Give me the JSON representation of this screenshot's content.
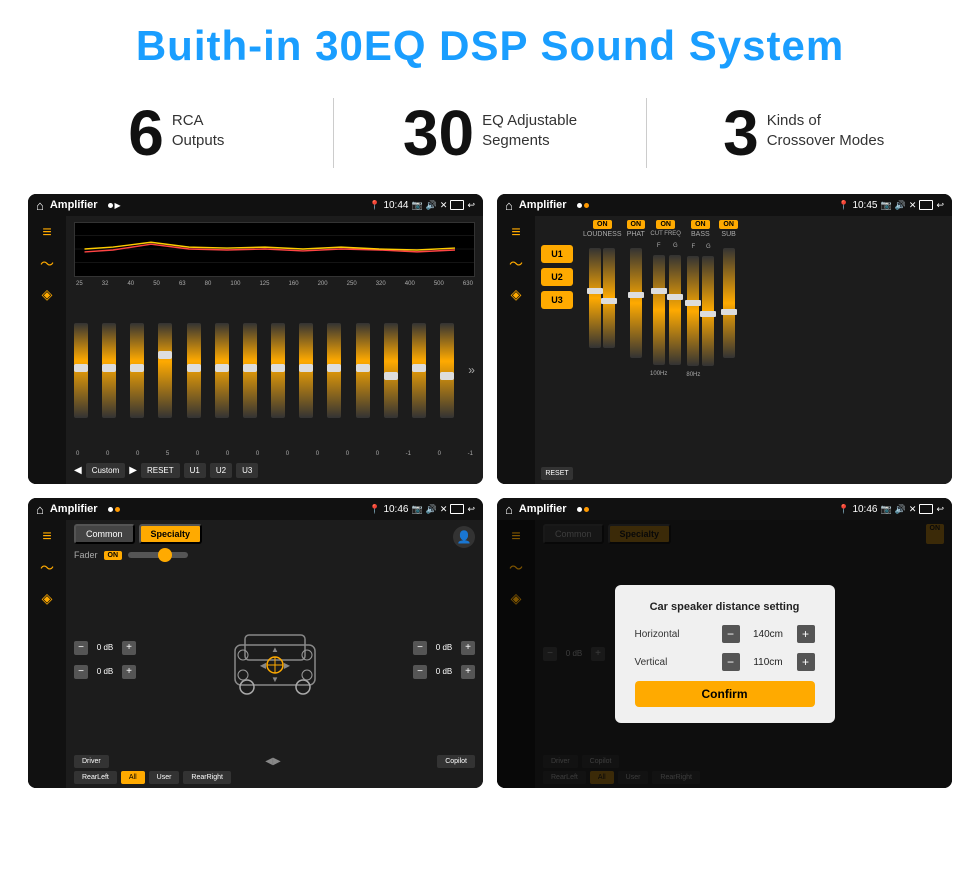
{
  "page": {
    "title": "Buith-in 30EQ DSP Sound System",
    "stats": [
      {
        "number": "6",
        "label_line1": "RCA",
        "label_line2": "Outputs"
      },
      {
        "number": "30",
        "label_line1": "EQ Adjustable",
        "label_line2": "Segments"
      },
      {
        "number": "3",
        "label_line1": "Kinds of",
        "label_line2": "Crossover Modes"
      }
    ]
  },
  "screen1": {
    "app": "Amplifier",
    "time": "10:44",
    "eq_labels": [
      "25",
      "32",
      "40",
      "50",
      "63",
      "80",
      "100",
      "125",
      "160",
      "200",
      "250",
      "320",
      "400",
      "500",
      "630"
    ],
    "eq_values": [
      "0",
      "0",
      "0",
      "5",
      "0",
      "0",
      "0",
      "0",
      "0",
      "0",
      "0",
      "-1",
      "0",
      "-1"
    ],
    "buttons": [
      "Custom",
      "RESET",
      "U1",
      "U2",
      "U3"
    ]
  },
  "screen2": {
    "app": "Amplifier",
    "time": "10:45",
    "presets": [
      "U1",
      "U2",
      "U3"
    ],
    "controls": [
      {
        "label": "LOUDNESS",
        "on": true
      },
      {
        "label": "PHAT",
        "on": true
      },
      {
        "label": "CUT FREQ",
        "on": true
      },
      {
        "label": "BASS",
        "on": true
      },
      {
        "label": "SUB",
        "on": true
      }
    ],
    "reset_label": "RESET"
  },
  "screen3": {
    "app": "Amplifier",
    "time": "10:46",
    "tabs": [
      "Common",
      "Specialty"
    ],
    "active_tab": "Specialty",
    "fader_label": "Fader",
    "on_label": "ON",
    "db_rows": [
      {
        "label": "0 dB",
        "side": "left"
      },
      {
        "label": "0 dB",
        "side": "left"
      },
      {
        "label": "0 dB",
        "side": "right"
      },
      {
        "label": "0 dB",
        "side": "right"
      }
    ],
    "bottom_buttons": [
      "Driver",
      "",
      "Copilot",
      "RearLeft",
      "All",
      "User",
      "RearRight"
    ]
  },
  "screen4": {
    "app": "Amplifier",
    "time": "10:46",
    "tabs": [
      "Common",
      "Specialty"
    ],
    "dialog": {
      "title": "Car speaker distance setting",
      "fields": [
        {
          "label": "Horizontal",
          "value": "140cm"
        },
        {
          "label": "Vertical",
          "value": "110cm"
        }
      ],
      "confirm_label": "Confirm"
    },
    "bottom_buttons": [
      "Driver",
      "Copilot",
      "RearLeft",
      "User",
      "RearRight"
    ]
  }
}
